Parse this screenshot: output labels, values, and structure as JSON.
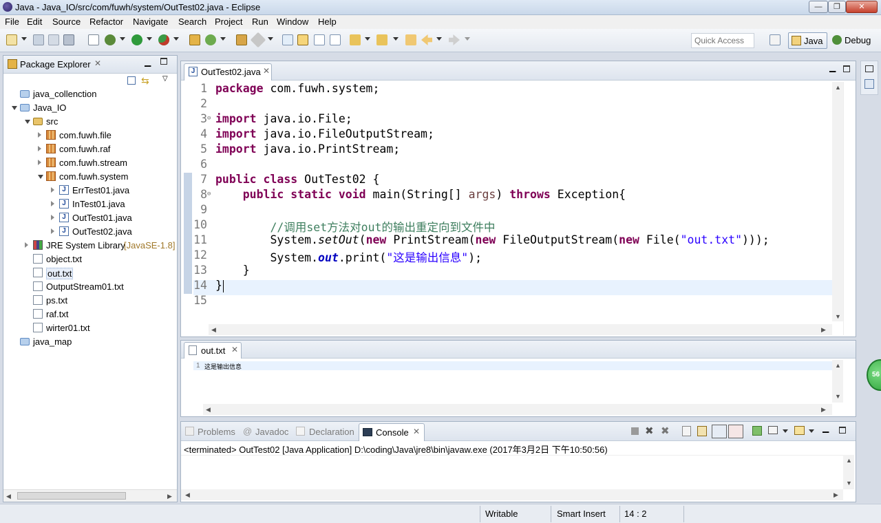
{
  "window": {
    "title": "Java - Java_IO/src/com/fuwh/system/OutTest02.java - Eclipse",
    "controls": {
      "minimize": "—",
      "maximize": "❐",
      "close": "✕"
    }
  },
  "menu": {
    "items": [
      "File",
      "Edit",
      "Source",
      "Refactor",
      "Navigate",
      "Search",
      "Project",
      "Run",
      "Window",
      "Help"
    ]
  },
  "toolbar": {
    "quick_access": "Quick Access",
    "perspective_java": "Java",
    "perspective_debug": "Debug"
  },
  "package_explorer": {
    "tab_label": "Package Explorer",
    "tree": [
      {
        "label": "java_collenction",
        "icon": "project-folder-icon",
        "level": 0,
        "expand": "none"
      },
      {
        "label": "Java_IO",
        "icon": "project-folder-icon",
        "level": 0,
        "expand": "open"
      },
      {
        "label": "src",
        "icon": "source-folder-icon",
        "level": 1,
        "expand": "open"
      },
      {
        "label": "com.fuwh.file",
        "icon": "package-icon",
        "level": 2,
        "expand": "closed"
      },
      {
        "label": "com.fuwh.raf",
        "icon": "package-icon",
        "level": 2,
        "expand": "closed"
      },
      {
        "label": "com.fuwh.stream",
        "icon": "package-icon",
        "level": 2,
        "expand": "closed"
      },
      {
        "label": "com.fuwh.system",
        "icon": "package-icon",
        "level": 2,
        "expand": "open"
      },
      {
        "label": "ErrTest01.java",
        "icon": "java-file-icon",
        "level": 3,
        "expand": "closed"
      },
      {
        "label": "InTest01.java",
        "icon": "java-file-icon",
        "level": 3,
        "expand": "closed"
      },
      {
        "label": "OutTest01.java",
        "icon": "java-file-icon",
        "level": 3,
        "expand": "closed"
      },
      {
        "label": "OutTest02.java",
        "icon": "java-file-icon",
        "level": 3,
        "expand": "closed"
      },
      {
        "label": "JRE System Library",
        "decoration": "[JavaSE-1.8]",
        "icon": "library-icon",
        "level": 1,
        "expand": "closed"
      },
      {
        "label": "object.txt",
        "icon": "text-file-icon",
        "level": 1,
        "expand": "none"
      },
      {
        "label": "out.txt",
        "icon": "text-file-icon",
        "level": 1,
        "expand": "none",
        "selected": true
      },
      {
        "label": "OutputStream01.txt",
        "icon": "text-file-icon",
        "level": 1,
        "expand": "none"
      },
      {
        "label": "ps.txt",
        "icon": "text-file-icon",
        "level": 1,
        "expand": "none"
      },
      {
        "label": "raf.txt",
        "icon": "text-file-icon",
        "level": 1,
        "expand": "none"
      },
      {
        "label": "wirter01.txt",
        "icon": "text-file-icon",
        "level": 1,
        "expand": "none"
      },
      {
        "label": "java_map",
        "icon": "project-folder-icon",
        "level": 0,
        "expand": "none"
      }
    ]
  },
  "editor": {
    "tab_label": "OutTest02.java",
    "cursor_line": 14,
    "lines": [
      {
        "n": "1",
        "tokens": [
          [
            "kw",
            "package"
          ],
          [
            "",
            "com.fuwh.system;"
          ]
        ]
      },
      {
        "n": "2",
        "tokens": []
      },
      {
        "n": "3",
        "fold": true,
        "tokens": [
          [
            "kw",
            "import"
          ],
          [
            "",
            "java.io.File;"
          ]
        ]
      },
      {
        "n": "4",
        "tokens": [
          [
            "kw",
            "import"
          ],
          [
            "",
            "java.io.FileOutputStream;"
          ]
        ]
      },
      {
        "n": "5",
        "tokens": [
          [
            "kw",
            "import"
          ],
          [
            "",
            "java.io.PrintStream;"
          ]
        ]
      },
      {
        "n": "6",
        "tokens": []
      },
      {
        "n": "7",
        "tokens": [
          [
            "kw",
            "public"
          ],
          [
            "kw",
            "class"
          ],
          [
            "",
            "OutTest02 {"
          ]
        ]
      },
      {
        "n": "8",
        "fold": true,
        "tokens": [
          [
            "",
            "    "
          ],
          [
            "kw",
            "public"
          ],
          [
            "kw",
            "static"
          ],
          [
            "kw",
            "void"
          ],
          [
            "",
            "main(String[] "
          ],
          [
            "var",
            "args"
          ],
          [
            "",
            ") "
          ],
          [
            "kw",
            "throws"
          ],
          [
            "",
            "Exception{"
          ]
        ]
      },
      {
        "n": "9",
        "tokens": []
      },
      {
        "n": "10",
        "tokens": [
          [
            "",
            "        "
          ],
          [
            "cm",
            "//调用set方法对out的输出重定向到文件中"
          ]
        ]
      },
      {
        "n": "11",
        "tokens": [
          [
            "",
            "        System."
          ],
          [
            "it",
            "setOut"
          ],
          [
            "",
            "("
          ],
          [
            "kw",
            "new"
          ],
          [
            "",
            "PrintStream("
          ],
          [
            "kw",
            "new"
          ],
          [
            "",
            "FileOutputStream("
          ],
          [
            "kw",
            "new"
          ],
          [
            "",
            "File("
          ],
          [
            "str",
            "\"out.txt\""
          ],
          [
            "",
            ")));"
          ]
        ]
      },
      {
        "n": "12",
        "tokens": [
          [
            "",
            "        System."
          ],
          [
            "fld",
            "out"
          ],
          [
            "",
            ".print("
          ],
          [
            "str",
            "\"这是输出信息\""
          ],
          [
            "",
            ");"
          ]
        ]
      },
      {
        "n": "13",
        "tokens": [
          [
            "",
            "    }"
          ]
        ]
      },
      {
        "n": "14",
        "tokens": [
          [
            "",
            "}"
          ]
        ]
      },
      {
        "n": "15",
        "tokens": []
      }
    ]
  },
  "out_editor": {
    "tab_label": "out.txt",
    "line_number": "1",
    "content": "这是输出信息"
  },
  "console": {
    "tabs": [
      "Problems",
      "Javadoc",
      "Declaration",
      "Console"
    ],
    "active_tab": "Console",
    "status_line": "<terminated> OutTest02 [Java Application] D:\\coding\\Java\\jre8\\bin\\javaw.exe (2017年3月2日 下午10:50:56)"
  },
  "statusbar": {
    "mode": "Writable",
    "insert": "Smart Insert",
    "position": "14 : 2"
  },
  "badge": {
    "value": "56"
  },
  "colors": {
    "keyword": "#7f0055",
    "comment": "#3f7f5f",
    "string": "#2a00ff",
    "field": "#0000c0",
    "current_line": "#e8f2fe"
  }
}
